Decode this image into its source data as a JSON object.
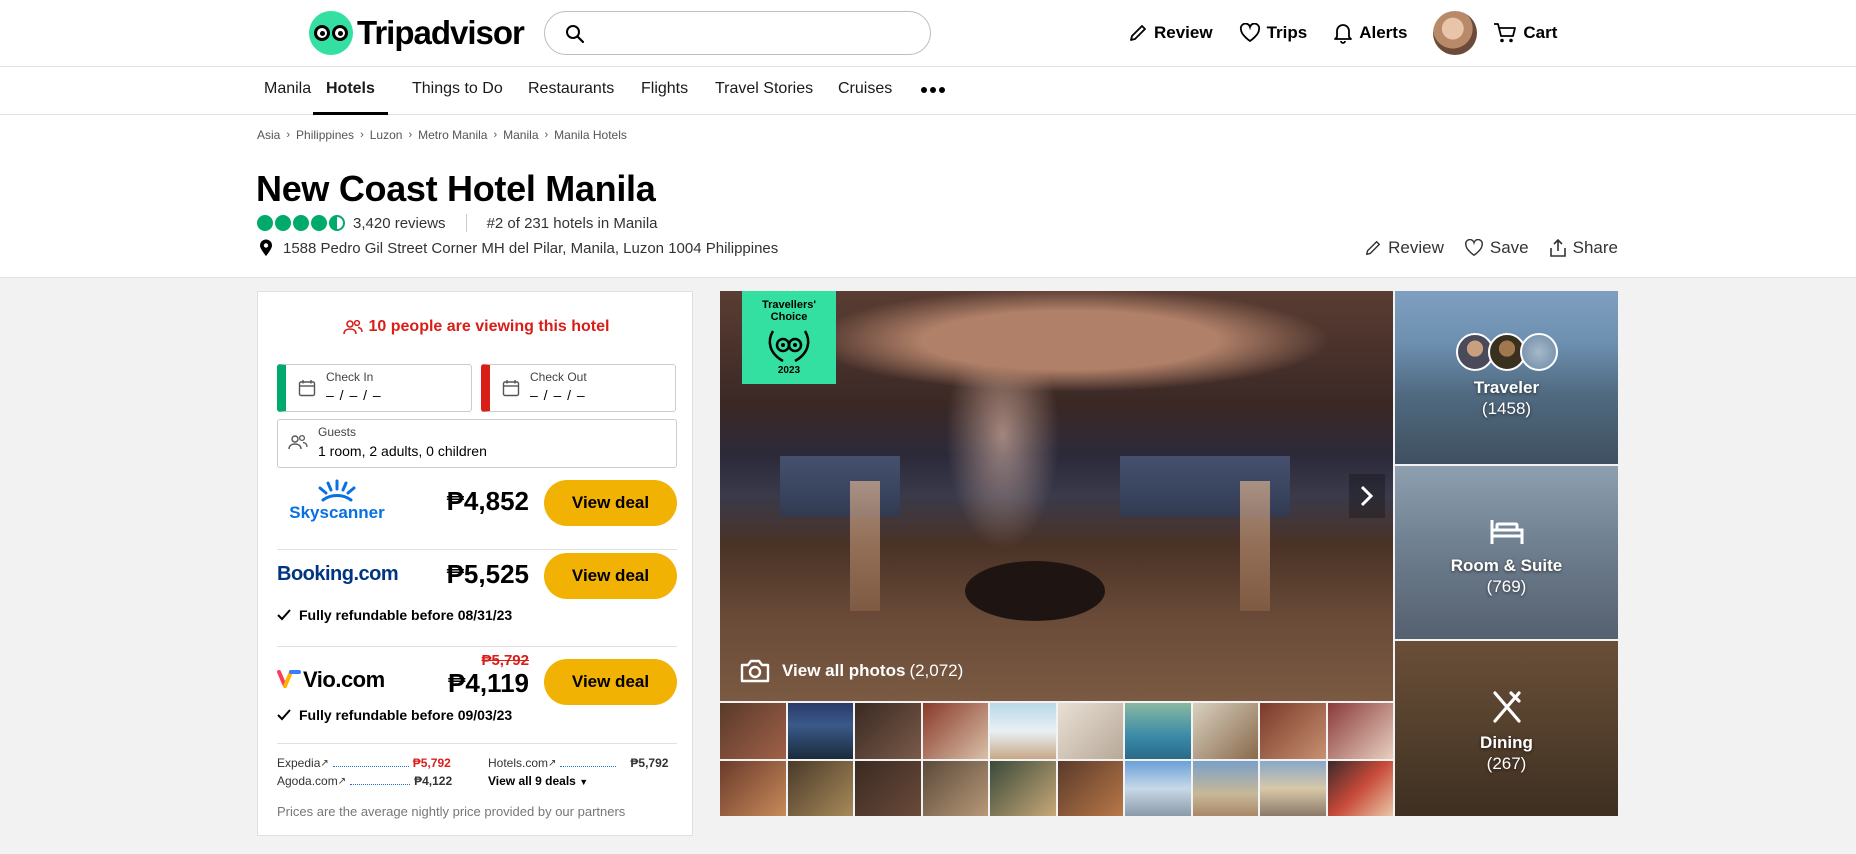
{
  "header": {
    "logo_text": "Tripadvisor",
    "search_placeholder": "",
    "actions": {
      "review": "Review",
      "trips": "Trips",
      "alerts": "Alerts",
      "cart": "Cart"
    }
  },
  "subnav": {
    "items": [
      "Manila",
      "Hotels",
      "Things to Do",
      "Restaurants",
      "Flights",
      "Travel Stories",
      "Cruises"
    ],
    "active": "Hotels"
  },
  "breadcrumbs": [
    "Asia",
    "Philippines",
    "Luzon",
    "Metro Manila",
    "Manila",
    "Manila Hotels"
  ],
  "hotel": {
    "name": "New Coast Hotel Manila",
    "rating": 4.5,
    "reviews": "3,420 reviews",
    "ranking": "#2 of 231 hotels in Manila",
    "address": "1588 Pedro Gil Street Corner MH del Pilar, Manila, Luzon 1004 Philippines"
  },
  "title_actions": {
    "review": "Review",
    "save": "Save",
    "share": "Share"
  },
  "booking": {
    "viewing": "10 people are viewing this hotel",
    "check_in_label": "Check In",
    "check_in_value": "– / – / –",
    "check_out_label": "Check Out",
    "check_out_value": "– / – / –",
    "guests_label": "Guests",
    "guests_value": "1 room, 2 adults, 0 children",
    "deals": [
      {
        "provider": "Skyscanner",
        "price": "₱4,852",
        "button": "View deal"
      },
      {
        "provider": "Booking.com",
        "price": "₱5,525",
        "button": "View deal",
        "note": "Fully refundable before 08/31/23"
      },
      {
        "provider": "Vio.com",
        "old_price": "₱5,792",
        "price": "₱4,119",
        "button": "View deal",
        "note": "Fully refundable before 09/03/23"
      }
    ],
    "other_deals": [
      {
        "provider": "Expedia",
        "price": "₱5,792"
      },
      {
        "provider": "Hotels.com",
        "price": "₱5,792"
      },
      {
        "provider": "Agoda.com",
        "price": "₱4,122"
      }
    ],
    "view_all": "View all 9 deals",
    "disclaimer": "Prices are the average nightly price provided by our partners"
  },
  "gallery": {
    "badge_line1": "Travellers'",
    "badge_line2": "Choice",
    "badge_year": "2023",
    "view_all_bold": "View all photos",
    "view_all_count": "(2,072)",
    "tiles": [
      {
        "label": "Traveler",
        "count": "(1458)"
      },
      {
        "label": "Room & Suite",
        "count": "(769)"
      },
      {
        "label": "Dining",
        "count": "(267)"
      }
    ]
  },
  "colors": {
    "brand_green": "#34e0a1",
    "rating_green": "#00aa6c",
    "alert_red": "#d91e18",
    "deal_yellow": "#f2b203"
  }
}
